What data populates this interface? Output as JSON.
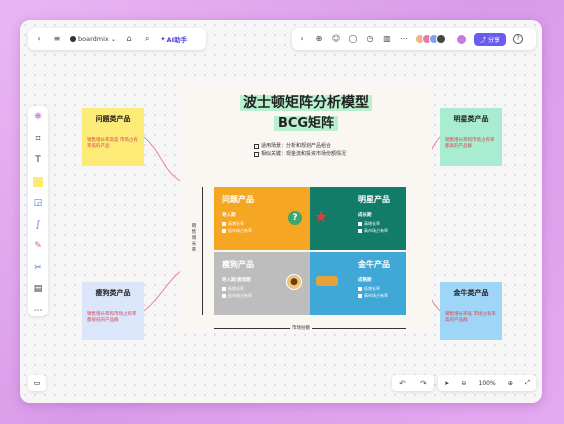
{
  "app": {
    "brand": "boardmix",
    "ai_label": "AI助手",
    "share_label": "分享"
  },
  "canvas": {
    "title_line1": "波士顿矩阵分析模型",
    "title_line2": "BCG矩阵",
    "legend": [
      "适用场景：分析和规划产品组合",
      "相似关键：现金流和投资市场份额情况"
    ],
    "y_axis_label": "销售增长率",
    "x_axis_label": "市场份额"
  },
  "quadrants": {
    "problem": {
      "title": "问题产品",
      "line0": "导入期",
      "line1": "高增长率",
      "line2": "低市场占有率"
    },
    "star": {
      "title": "明星产品",
      "line0": "成长期",
      "line1": "高增长率",
      "line2": "高市场占有率"
    },
    "dog": {
      "title": "瘦狗产品",
      "line0": "导入期/衰退期",
      "line1": "低增长率",
      "line2": "低市场占有率"
    },
    "cow": {
      "title": "金牛产品",
      "line0": "成熟期",
      "line1": "低增长率",
      "line2": "高市场占有率"
    }
  },
  "stickies": {
    "problem": {
      "title": "问题类产品",
      "body": "销售增长率高是 市场占有率低的产品"
    },
    "dog": {
      "title": "瘦狗类产品",
      "body": "销售增长率和市场占有率 都很低的产品群"
    },
    "star": {
      "title": "明星类产品",
      "body": "销售增长率和市场占有率 都高的产品群"
    },
    "cow": {
      "title": "金牛类产品",
      "body": "销售增长率低 市场占有率高的产品群"
    }
  },
  "zoom": "100%",
  "colors": {
    "problem": "#f5a623",
    "star": "#137c68",
    "dog": "#bdbdbd",
    "cow": "#3fa8d6",
    "accent": "#6b5cf0"
  },
  "icons": [
    "back-icon",
    "menu-icon",
    "tag-icon",
    "search-icon",
    "share-icon"
  ]
}
